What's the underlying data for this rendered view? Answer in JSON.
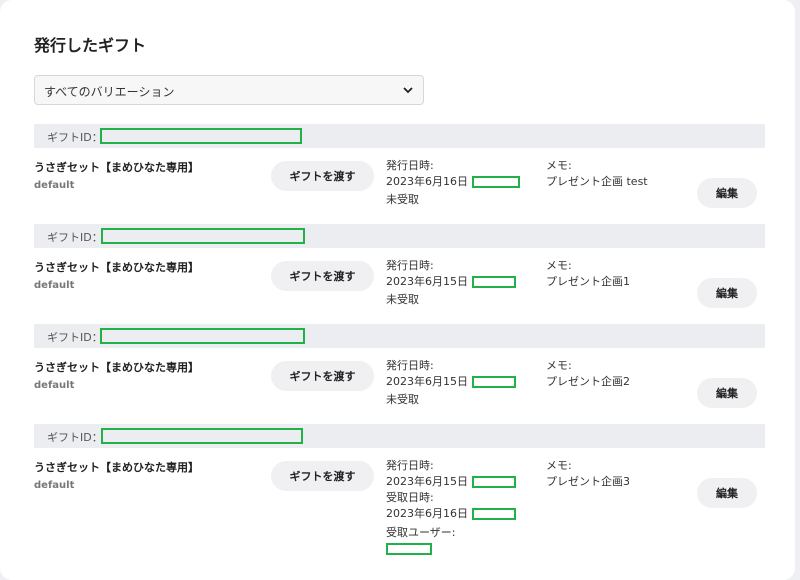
{
  "page": {
    "title": "発行したギフト"
  },
  "filter": {
    "selected": "すべてのバリエーション"
  },
  "labels": {
    "gift_id": "ギフトID：",
    "issued": "発行日時:",
    "received": "受取日時:",
    "receiver": "受取ユーザー:",
    "memo": "メモ:",
    "pass_button": "ギフトを渡す",
    "edit_button": "編集"
  },
  "colors": {
    "redaction": "#22b04a",
    "id_bar": "#ebedf0",
    "button_bg": "#f0f0f2"
  },
  "gifts": [
    {
      "product": "うさぎセット【まめひなた専用】",
      "variant": "default",
      "issued_date": "2023年6月16日",
      "status": "未受取",
      "memo": "プレゼント企画 test"
    },
    {
      "product": "うさぎセット【まめひなた専用】",
      "variant": "default",
      "issued_date": "2023年6月15日",
      "status": "未受取",
      "memo": "プレゼント企画1"
    },
    {
      "product": "うさぎセット【まめひなた専用】",
      "variant": "default",
      "issued_date": "2023年6月15日",
      "status": "未受取",
      "memo": "プレゼント企画2"
    },
    {
      "product": "うさぎセット【まめひなた専用】",
      "variant": "default",
      "issued_date": "2023年6月15日",
      "received_date": "2023年6月16日",
      "memo": "プレゼント企画3"
    }
  ]
}
